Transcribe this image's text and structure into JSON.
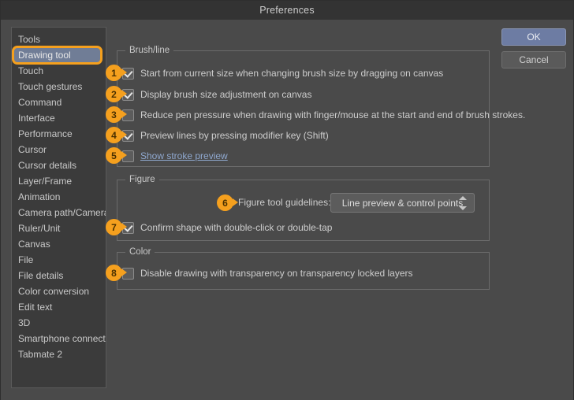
{
  "window": {
    "title": "Preferences"
  },
  "sidebar": {
    "items": [
      {
        "label": "Tools",
        "selected": false
      },
      {
        "label": "Drawing tool",
        "selected": true
      },
      {
        "label": "Touch",
        "selected": false
      },
      {
        "label": "Touch gestures",
        "selected": false
      },
      {
        "label": "Command",
        "selected": false
      },
      {
        "label": "Interface",
        "selected": false
      },
      {
        "label": "Performance",
        "selected": false
      },
      {
        "label": "Cursor",
        "selected": false
      },
      {
        "label": "Cursor details",
        "selected": false
      },
      {
        "label": "Layer/Frame",
        "selected": false
      },
      {
        "label": "Animation",
        "selected": false
      },
      {
        "label": "Camera path/Camera",
        "selected": false
      },
      {
        "label": "Ruler/Unit",
        "selected": false
      },
      {
        "label": "Canvas",
        "selected": false
      },
      {
        "label": "File",
        "selected": false
      },
      {
        "label": "File details",
        "selected": false
      },
      {
        "label": "Color conversion",
        "selected": false
      },
      {
        "label": "Edit text",
        "selected": false
      },
      {
        "label": "3D",
        "selected": false
      },
      {
        "label": "Smartphone connection",
        "selected": false
      },
      {
        "label": "Tabmate 2",
        "selected": false
      }
    ]
  },
  "buttons": {
    "ok": "OK",
    "cancel": "Cancel"
  },
  "groups": {
    "brush": {
      "legend": "Brush/line"
    },
    "figure": {
      "legend": "Figure"
    },
    "color": {
      "legend": "Color"
    }
  },
  "checkboxes": {
    "c1": {
      "badge": "1",
      "label": "Start from current size when changing brush size by dragging on canvas",
      "checked": true
    },
    "c2": {
      "badge": "2",
      "label": "Display brush size adjustment on canvas",
      "checked": true
    },
    "c3": {
      "badge": "3",
      "label": "Reduce pen pressure when drawing with finger/mouse at the start and end of brush strokes.",
      "checked": false
    },
    "c4": {
      "badge": "4",
      "label": "Preview lines by pressing modifier key (Shift)",
      "checked": true
    },
    "c5": {
      "badge": "5",
      "label": "Show stroke preview",
      "checked": false,
      "is_link": true
    },
    "c7": {
      "badge": "7",
      "label": "Confirm shape with double-click or double-tap",
      "checked": true
    },
    "c8": {
      "badge": "8",
      "label": "Disable drawing with transparency on transparency locked layers",
      "checked": false
    }
  },
  "figure_tool_guidelines": {
    "badge": "6",
    "label": "Figure tool guidelines:",
    "value": "Line preview & control points"
  },
  "colors": {
    "accent_orange": "#f5a01e",
    "dialog_bg": "#4a4a4a",
    "titlebar_bg": "#333333",
    "sidebar_bg": "#3b3b3b",
    "selection_blue": "#707d96",
    "ok_button": "#6d7ca3",
    "link_blue": "#8fa8cf"
  }
}
